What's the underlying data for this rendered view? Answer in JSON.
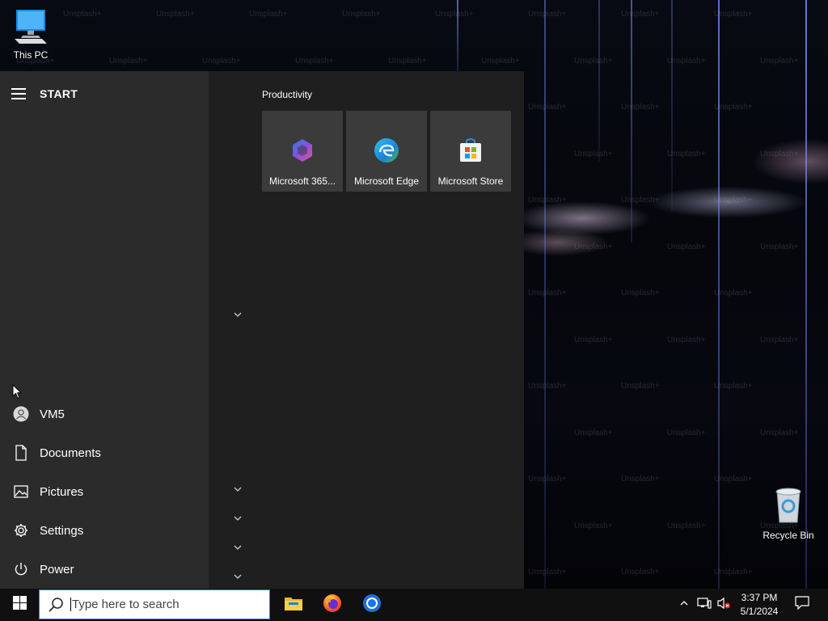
{
  "desktop": {
    "icons": [
      {
        "label": "This PC"
      },
      {
        "label": "Recycle Bin"
      }
    ],
    "watermark": "Unsplash+"
  },
  "start_menu": {
    "title": "START",
    "nav_items": [
      {
        "label": "VM5",
        "icon": "user-icon"
      },
      {
        "label": "Documents",
        "icon": "document-icon"
      },
      {
        "label": "Pictures",
        "icon": "pictures-icon"
      },
      {
        "label": "Settings",
        "icon": "gear-icon"
      },
      {
        "label": "Power",
        "icon": "power-icon"
      }
    ],
    "group_title": "Productivity",
    "tiles": [
      {
        "label": "Microsoft 365...",
        "icon": "microsoft-365-icon"
      },
      {
        "label": "Microsoft Edge",
        "icon": "edge-icon"
      },
      {
        "label": "Microsoft Store",
        "icon": "store-icon"
      }
    ]
  },
  "taskbar": {
    "search_placeholder": "Type here to search",
    "apps": [
      {
        "name": "File Explorer",
        "icon": "folder-icon"
      },
      {
        "name": "Firefox",
        "icon": "firefox-icon"
      },
      {
        "name": "Chrome",
        "icon": "chrome-icon"
      }
    ],
    "clock": {
      "time": "3:37 PM",
      "date": "5/1/2024"
    }
  },
  "colors": {
    "accent": "#3a7bd5",
    "start_left": "#2b2b2b",
    "start_right": "#1f1f1f",
    "tile": "#3b3b3b",
    "taskbar": "#101010"
  }
}
